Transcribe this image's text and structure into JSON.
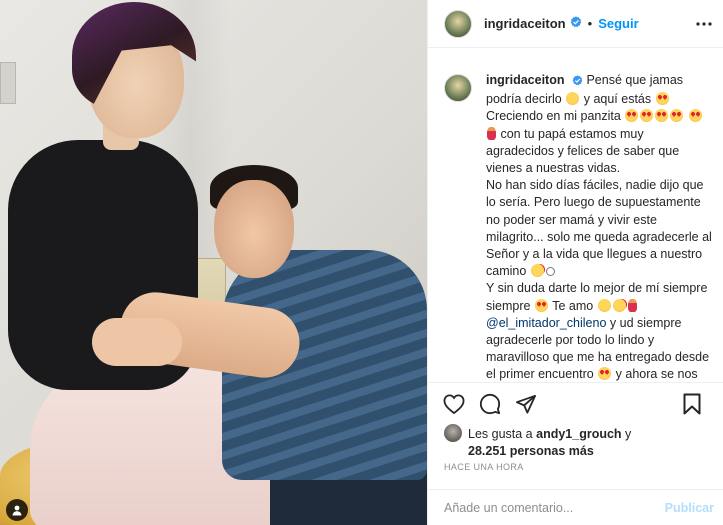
{
  "header": {
    "username": "ingridaceiton",
    "separator": "•",
    "follow_label": "Seguir",
    "more_icon": "more-horizontal-icon"
  },
  "caption": {
    "username": "ingridaceiton",
    "lines": {
      "t1": "Pensé que jamas podría decirlo",
      "t2": "y aquí estás",
      "t3": "Creciendo en mi panzita",
      "t4": "con tu papá estamos muy agradecidos y felices de saber que vienes a nuestras vidas.",
      "t5": "No han sido días fáciles, nadie dijo que lo sería. Pero luego de supuestamente no poder ser mamá y vivir este milagrito... solo me queda agradecerle al Señor y a la vida que llegues a nuestro camino",
      "t6": "Y sin duda darte lo mejor de mí siempre siempre",
      "t7": "Te amo",
      "mention": "@el_imitador_chileno",
      "t8": "y ud siempre agradecerle por todo lo lindo y maravilloso que me ha entregado desde el primer encuentro",
      "t9": "y ahora se nos úne una personita más."
    }
  },
  "likes": {
    "prefix": "Les gusta a",
    "user": "andy1_grouch",
    "conj": "y",
    "count_text": "28.251 personas más"
  },
  "timestamp": "HACE UNA HORA",
  "comment_box": {
    "placeholder": "Añade un comentario...",
    "publish_label": "Publicar"
  },
  "colors": {
    "accent": "#0095f6",
    "publish_disabled": "#b2dffc",
    "mention": "#00376b",
    "muted": "#8e8e8e",
    "border": "#efefef"
  },
  "icons": [
    "verified-badge-icon",
    "heart-icon",
    "comment-icon",
    "share-icon",
    "bookmark-icon",
    "user-tag-icon",
    "more-horizontal-icon"
  ]
}
